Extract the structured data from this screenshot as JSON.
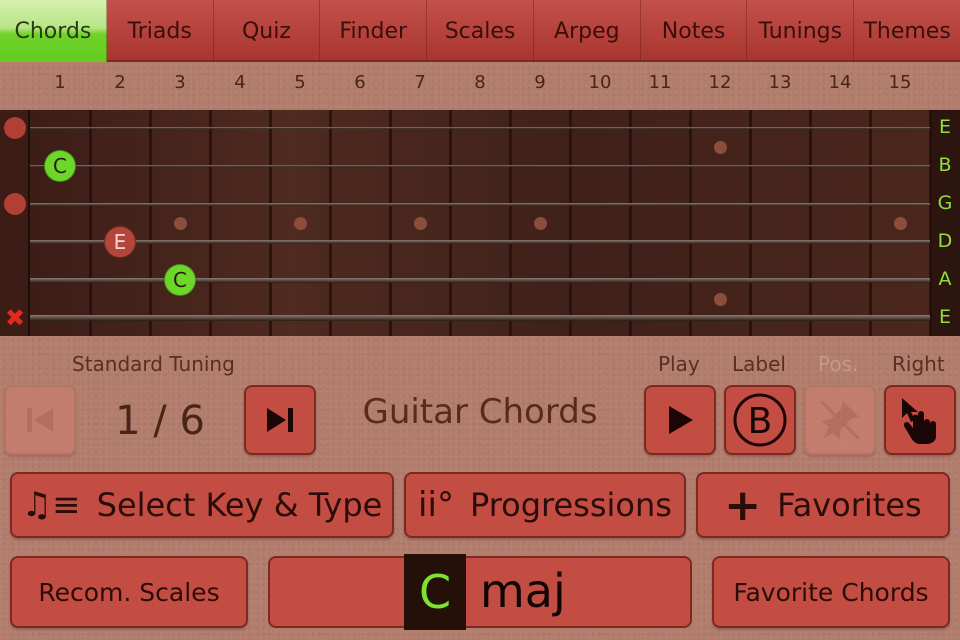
{
  "tabs": [
    {
      "label": "Chords",
      "active": true
    },
    {
      "label": "Triads"
    },
    {
      "label": "Quiz"
    },
    {
      "label": "Finder"
    },
    {
      "label": "Scales"
    },
    {
      "label": "Arpeg"
    },
    {
      "label": "Notes"
    },
    {
      "label": "Tunings"
    },
    {
      "label": "Themes"
    }
  ],
  "fret_numbers": [
    "1",
    "2",
    "3",
    "4",
    "5",
    "6",
    "7",
    "8",
    "9",
    "10",
    "11",
    "12",
    "13",
    "14",
    "15"
  ],
  "string_names": [
    "E",
    "B",
    "G",
    "D",
    "A",
    "E"
  ],
  "inlay_frets": [
    3,
    5,
    7,
    9,
    15
  ],
  "double_inlay_fret": 12,
  "string_states": [
    "open",
    "",
    "open",
    "",
    "",
    "mute"
  ],
  "notes": [
    {
      "label": "C",
      "string": 1,
      "fret": 1,
      "role": "root"
    },
    {
      "label": "E",
      "string": 3,
      "fret": 2,
      "role": "third"
    },
    {
      "label": "C",
      "string": 4,
      "fret": 3,
      "role": "root"
    }
  ],
  "colors": {
    "root": "#6cd62a",
    "third": "#b4453a",
    "accent": "#c44d43",
    "active_tab": "#63cc1e"
  },
  "controls": {
    "tuning_label": "Standard Tuning",
    "page_counter": "1 / 6",
    "title": "Guitar Chords",
    "play_label": "Play",
    "label_label": "Label",
    "label_value": "B",
    "pos_label": "Pos.",
    "right_label": "Right"
  },
  "buttons": {
    "select_key": "Select Key & Type",
    "progressions": "Progressions",
    "progressions_icon_text": "ii°",
    "favorites": "Favorites",
    "recom_scales": "Recom. Scales",
    "favorite_chords": "Favorite Chords"
  },
  "chord": {
    "root": "C",
    "type": "maj"
  }
}
